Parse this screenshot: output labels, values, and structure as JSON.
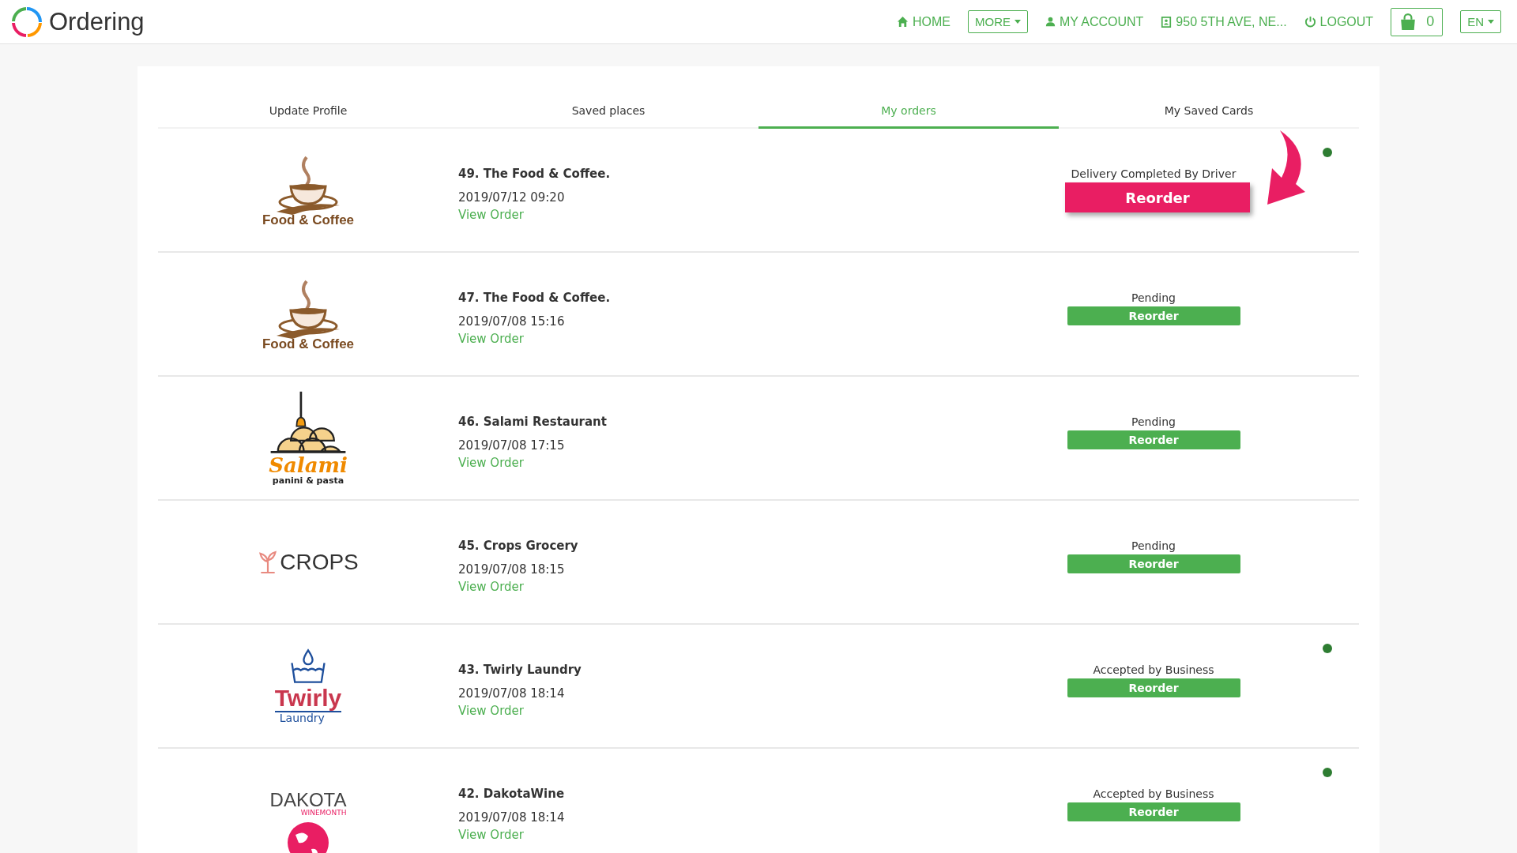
{
  "header": {
    "brand": "Ordering",
    "nav": [
      {
        "kind": "home",
        "label": "HOME"
      },
      {
        "kind": "dropdown",
        "label": "MORE"
      },
      {
        "kind": "account",
        "label": "MY ACCOUNT"
      },
      {
        "kind": "address",
        "label": "950 5TH AVE, NE..."
      },
      {
        "kind": "logout",
        "label": "LOGOUT"
      }
    ],
    "cart_count": "0",
    "language": "EN"
  },
  "tabs": [
    {
      "label": "Update Profile",
      "selected": false
    },
    {
      "label": "Saved places",
      "selected": false
    },
    {
      "label": "My orders",
      "selected": true
    },
    {
      "label": "My Saved Cards",
      "selected": false
    }
  ],
  "orders": [
    {
      "logo": {
        "kind": "coffee",
        "lines": [
          "Food & Coffee"
        ]
      },
      "title": "49. The Food & Coffee.",
      "date": "2019/07/12 09:20",
      "link": "View Order",
      "status": "Delivery Completed By Driver",
      "button": "Reorder",
      "highlighted": true,
      "unread": true
    },
    {
      "logo": {
        "kind": "coffee",
        "lines": [
          "Food & Coffee"
        ]
      },
      "title": "47. The Food & Coffee.",
      "date": "2019/07/08 15:16",
      "link": "View Order",
      "status": "Pending",
      "button": "Reorder",
      "highlighted": false,
      "unread": false
    },
    {
      "logo": {
        "kind": "salami",
        "lines": [
          "Salami",
          "panini & pasta"
        ]
      },
      "title": "46. Salami Restaurant",
      "date": "2019/07/08 17:15",
      "link": "View Order",
      "status": "Pending",
      "button": "Reorder",
      "highlighted": false,
      "unread": false
    },
    {
      "logo": {
        "kind": "crops",
        "lines": [
          "CROPS"
        ]
      },
      "title": "45. Crops Grocery",
      "date": "2019/07/08 18:15",
      "link": "View Order",
      "status": "Pending",
      "button": "Reorder",
      "highlighted": false,
      "unread": false
    },
    {
      "logo": {
        "kind": "laundry",
        "lines": [
          "Twirly",
          "Laundry"
        ]
      },
      "title": "43. Twirly Laundry",
      "date": "2019/07/08 18:14",
      "link": "View Order",
      "status": "Accepted by Business",
      "button": "Reorder",
      "highlighted": false,
      "unread": true
    },
    {
      "logo": {
        "kind": "wine",
        "lines": [
          "DAKOTA",
          "WINEMONTH"
        ]
      },
      "title": "42. DakotaWine",
      "date": "2019/07/08 18:14",
      "link": "View Order",
      "status": "Accepted by Business",
      "button": "Reorder",
      "highlighted": false,
      "unread": true
    }
  ]
}
